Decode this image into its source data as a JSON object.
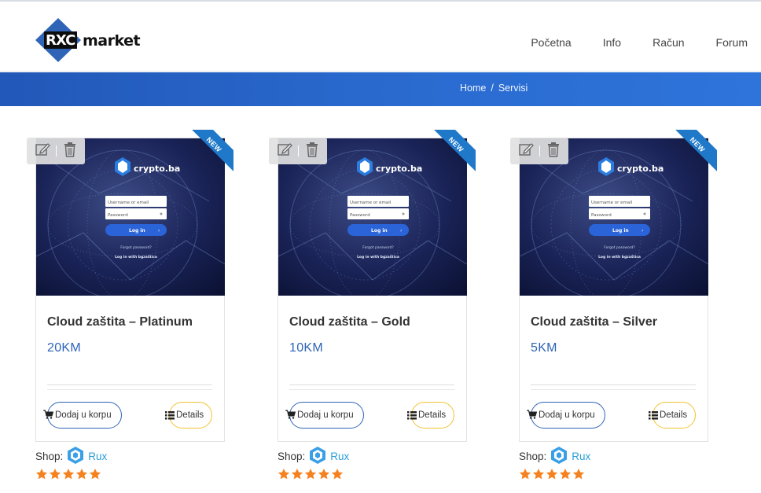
{
  "header": {
    "logo": {
      "box_text": "RXC",
      "word": "market"
    },
    "nav": [
      "Početna",
      "Info",
      "Račun",
      "Forum"
    ]
  },
  "breadcrumb": {
    "home": "Home",
    "separator": "/",
    "current": "Servisi"
  },
  "products": [
    {
      "title": "Cloud zaštita – Platinum",
      "price": "20KM",
      "badge": "NEW",
      "image": {
        "brand": "crypto.ba",
        "username_placeholder": "Username or email",
        "password_placeholder": "Password",
        "login_label": "Log in",
        "forgot": "Forgot password?",
        "login_with": "Log in with bgzaštica"
      },
      "add_to_cart": "Dodaj u korpu",
      "details": "Details",
      "shop_label": "Shop:",
      "shop_name": "Rux",
      "rating": 5
    },
    {
      "title": "Cloud zaštita – Gold",
      "price": "10KM",
      "badge": "NEW",
      "image": {
        "brand": "crypto.ba",
        "username_placeholder": "Username or email",
        "password_placeholder": "Password",
        "login_label": "Log in",
        "forgot": "Forgot password?",
        "login_with": "Log in with bgzaštica"
      },
      "add_to_cart": "Dodaj u korpu",
      "details": "Details",
      "shop_label": "Shop:",
      "shop_name": "Rux",
      "rating": 5
    },
    {
      "title": "Cloud zaštita – Silver",
      "price": "5KM",
      "badge": "NEW",
      "image": {
        "brand": "crypto.ba",
        "username_placeholder": "Username or email",
        "password_placeholder": "Password",
        "login_label": "Log in",
        "forgot": "Forgot password?",
        "login_with": "Log in with bgzaštica"
      },
      "add_to_cart": "Dodaj u korpu",
      "details": "Details",
      "shop_label": "Shop:",
      "shop_name": "Rux",
      "rating": 5
    }
  ],
  "colors": {
    "accent": "#2f64b6",
    "band": "#2a6bd0",
    "details_border": "#f2c233",
    "star": "#f58220",
    "shop_link": "#2a9fd6",
    "ribbon": "#1f79c8"
  },
  "icons": {
    "edit": "pencil-icon",
    "delete": "trash-icon",
    "cart": "cart-icon",
    "details": "list-icon",
    "shop": "shop-logo-icon",
    "star": "star-icon"
  }
}
